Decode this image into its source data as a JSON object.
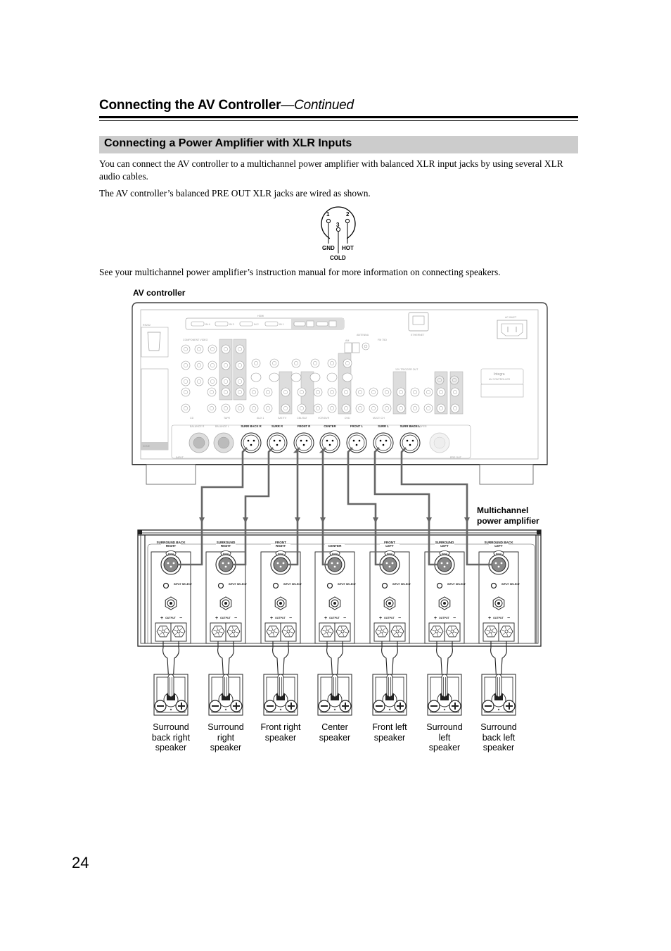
{
  "header": {
    "title": "Connecting the AV Controller",
    "continued": "—Continued"
  },
  "section": {
    "title": "Connecting a Power Amplifier with XLR Inputs"
  },
  "paragraphs": [
    "You can connect the AV controller to a multichannel power amplifier with balanced XLR input jacks by using several XLR audio cables.",
    "The AV controller’s balanced PRE OUT XLR jacks are wired as shown.",
    "See your multichannel power amplifier’s instruction manual for more information on connecting speakers."
  ],
  "xlr_pinout": {
    "pins": [
      "1",
      "2",
      "3"
    ],
    "labels": {
      "gnd": "GND",
      "hot": "HOT",
      "cold": "COLD"
    }
  },
  "diagram": {
    "controller_label": "AV controller",
    "amplifier_label_line1": "Multichannel",
    "amplifier_label_line2": "power amplifier",
    "controller_panel": {
      "hdmi_label": "HDMI",
      "hdmi_inputs": [
        "IN 4",
        "IN 3",
        "IN 2",
        "IN 1"
      ],
      "antenna_label": "ANTENNA",
      "am_label": "AM",
      "fm_label": "FM 75Ω",
      "ethernet_label": "ETHERNET",
      "ac_inlet_label": "AC INLET",
      "rs232_label": "RS232",
      "component_label": "COMPONENT VIDEO",
      "trigger_label": "12V TRIGGER OUT",
      "brand_label": "Integra",
      "model_label": "AV CONTROLLER",
      "balance_r": "BALANCE R",
      "balance_l": "BALANCE L",
      "subwoofer": "SUBWOOFER",
      "input_label": "INPUT",
      "preout_label": "PRE OUT",
      "analog_row": [
        "CD",
        "TAPE",
        "AUX 1",
        "SAT/TV",
        "CBL/SAT",
        "VCR/DVR",
        "DVD",
        "MULTI CH"
      ],
      "xlr_outputs": [
        "SURR BACK R",
        "SURR R",
        "FRONT R",
        "CENTER",
        "FRONT L",
        "SURR L",
        "SURR BACK L"
      ],
      "zone_label": "ZONE"
    },
    "amplifier_channels": [
      {
        "line1": "SURROUND BACK",
        "line2": "RIGHT"
      },
      {
        "line1": "SURROUND",
        "line2": "RIGHT"
      },
      {
        "line1": "FRONT",
        "line2": "RIGHT"
      },
      {
        "line1": "",
        "line2": "CENTER"
      },
      {
        "line1": "FRONT",
        "line2": "LEFT"
      },
      {
        "line1": "SURROUND",
        "line2": "LEFT"
      },
      {
        "line1": "SURROUND BACK",
        "line2": "LEFT"
      }
    ],
    "amp_channel_common": {
      "push": "PUSH",
      "input_select": "INPUT SELECT",
      "output": "OUTPUT",
      "plus": "+",
      "minus": "−"
    },
    "speakers": [
      [
        "Surround",
        "back right",
        "speaker"
      ],
      [
        "Surround",
        "right",
        "speaker"
      ],
      [
        "Front right",
        "speaker"
      ],
      [
        "Center",
        "speaker"
      ],
      [
        "Front left",
        "speaker"
      ],
      [
        "Surround",
        "left",
        "speaker"
      ],
      [
        "Surround",
        "back left",
        "speaker"
      ]
    ]
  },
  "page_number": "24"
}
